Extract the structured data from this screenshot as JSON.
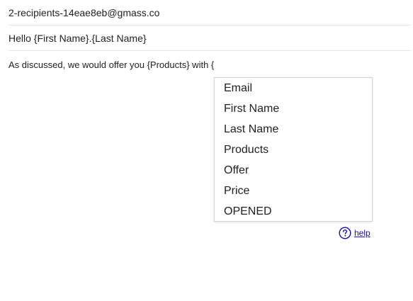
{
  "compose": {
    "to": "2-recipients-14eae8eb@gmass.co",
    "subject": "Hello {First Name}.{Last Name}",
    "body": "As discussed, we would offer you {Products} with {"
  },
  "autocomplete": {
    "items": [
      "Email",
      "First Name",
      "Last Name",
      "Products",
      "Offer",
      "Price",
      "OPENED"
    ]
  },
  "help": {
    "icon": "question-circle-icon",
    "label": "help",
    "color": "#1a0dab"
  }
}
